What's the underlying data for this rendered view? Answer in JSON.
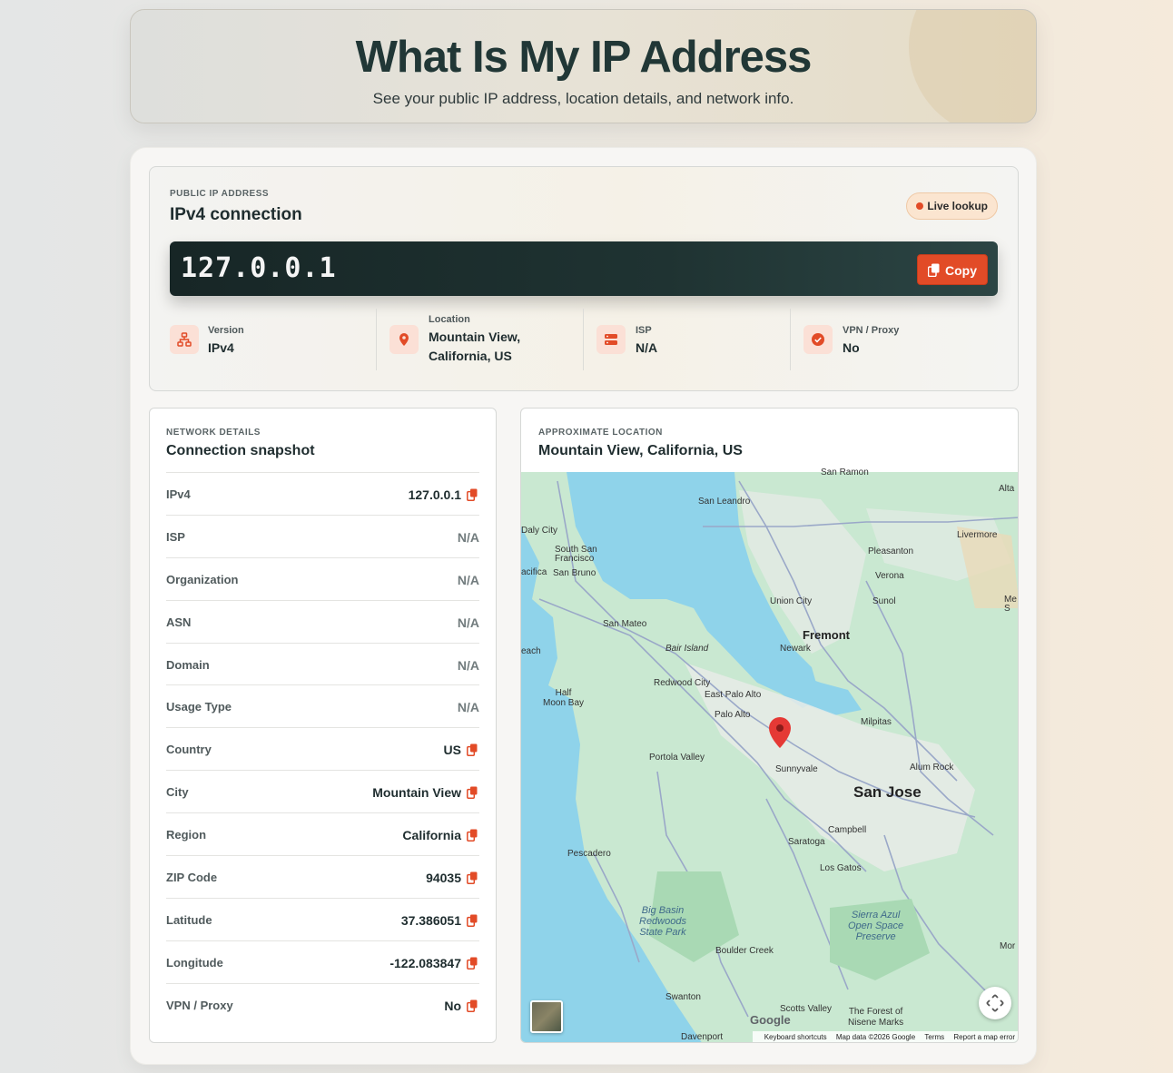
{
  "header": {
    "title": "What Is My IP Address",
    "subtitle": "See your public IP address, location details, and network info."
  },
  "ip_panel": {
    "eyebrow": "PUBLIC IP ADDRESS",
    "title": "IPv4 connection",
    "badge": "Live lookup",
    "ip": "127.0.0.1",
    "copy_label": "Copy",
    "stats": [
      {
        "label": "Version",
        "value": "IPv4",
        "icon": "network-icon"
      },
      {
        "label": "Location",
        "value": "Mountain View, California, US",
        "icon": "location-pin-icon"
      },
      {
        "label": "ISP",
        "value": "N/A",
        "icon": "server-icon"
      },
      {
        "label": "VPN / Proxy",
        "value": "No",
        "icon": "check-circle-icon"
      }
    ]
  },
  "network": {
    "eyebrow": "NETWORK DETAILS",
    "title": "Connection snapshot",
    "rows": [
      {
        "key": "IPv4",
        "value": "127.0.0.1",
        "copy": true
      },
      {
        "key": "ISP",
        "value": "N/A",
        "copy": false
      },
      {
        "key": "Organization",
        "value": "N/A",
        "copy": false
      },
      {
        "key": "ASN",
        "value": "N/A",
        "copy": false
      },
      {
        "key": "Domain",
        "value": "N/A",
        "copy": false
      },
      {
        "key": "Usage Type",
        "value": "N/A",
        "copy": false
      },
      {
        "key": "Country",
        "value": "US",
        "copy": true
      },
      {
        "key": "City",
        "value": "Mountain View",
        "copy": true
      },
      {
        "key": "Region",
        "value": "California",
        "copy": true
      },
      {
        "key": "ZIP Code",
        "value": "94035",
        "copy": true
      },
      {
        "key": "Latitude",
        "value": "37.386051",
        "copy": true
      },
      {
        "key": "Longitude",
        "value": "-122.083847",
        "copy": true
      },
      {
        "key": "VPN / Proxy",
        "value": "No",
        "copy": true
      }
    ]
  },
  "map_panel": {
    "eyebrow": "APPROXIMATE LOCATION",
    "title": "Mountain View, California, US",
    "labels": {
      "san_ramon": "San Ramon",
      "san_leandro": "San Leandro",
      "alta": "Alta",
      "daly_city": "Daly City",
      "livermore": "Livermore",
      "south_sf": "South San\nFrancisco",
      "pleasanton": "Pleasanton",
      "pacifica": "acifica",
      "san_bruno": "San Bruno",
      "verona": "Verona",
      "union_city": "Union City",
      "sunol": "Sunol",
      "san_mateo": "San Mateo",
      "fremont": "Fremont",
      "bair_island": "Bair Island",
      "newark": "Newark",
      "beach": "each",
      "redwood_city": "Redwood City",
      "half_moon_bay": "Half\nMoon Bay",
      "east_palo_alto": "East Palo Alto",
      "palo_alto": "Palo Alto",
      "milpitas": "Milpitas",
      "portola_valley": "Portola Valley",
      "sunnyvale": "Sunnyvale",
      "alum_rock": "Alum Rock",
      "san_jose": "San Jose",
      "campbell": "Campbell",
      "saratoga": "Saratoga",
      "pescadero": "Pescadero",
      "los_gatos": "Los Gatos",
      "big_basin": "Big Basin\nRedwoods\nState Park",
      "sierra_azul": "Sierra Azul\nOpen Space\nPreserve",
      "boulder_creek": "Boulder Creek",
      "swanton": "Swanton",
      "scotts_valley": "Scotts Valley",
      "forest_nisene": "The Forest of\nNisene Marks",
      "davenport": "Davenport",
      "mor": "Mor",
      "me": "Me\nS"
    },
    "google": "Google",
    "attribution": {
      "shortcuts": "Keyboard shortcuts",
      "data": "Map data ©2026 Google",
      "terms": "Terms",
      "report": "Report a map error"
    }
  },
  "colors": {
    "accent": "#e24b27",
    "ink": "#1f2d2f",
    "water": "#8fd3ea",
    "land": "#c8e6cf"
  }
}
